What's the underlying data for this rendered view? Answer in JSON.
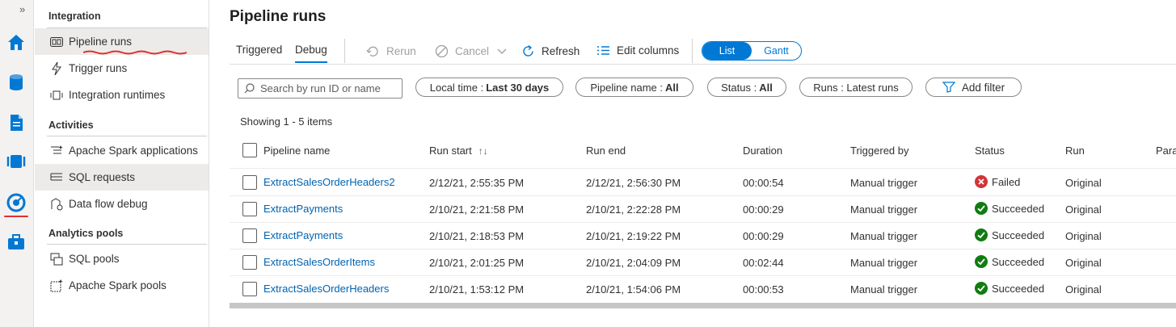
{
  "rail": {
    "expand_glyph": "»",
    "icons": [
      "home-icon",
      "data-icon",
      "develop-icon",
      "integrate-icon",
      "monitor-icon",
      "manage-icon"
    ]
  },
  "nav": {
    "sections": [
      {
        "title": "Integration",
        "items": [
          {
            "label": "Pipeline runs",
            "icon": "pipeline-runs-icon"
          },
          {
            "label": "Trigger runs",
            "icon": "trigger-runs-icon"
          },
          {
            "label": "Integration runtimes",
            "icon": "integration-runtimes-icon"
          }
        ]
      },
      {
        "title": "Activities",
        "items": [
          {
            "label": "Apache Spark applications",
            "icon": "spark-applications-icon"
          },
          {
            "label": "SQL requests",
            "icon": "sql-requests-icon"
          },
          {
            "label": "Data flow debug",
            "icon": "data-flow-debug-icon"
          }
        ]
      },
      {
        "title": "Analytics pools",
        "items": [
          {
            "label": "SQL pools",
            "icon": "sql-pools-icon"
          },
          {
            "label": "Apache Spark pools",
            "icon": "spark-pools-icon"
          }
        ]
      }
    ]
  },
  "main": {
    "title": "Pipeline runs",
    "tabs": [
      "Triggered",
      "Debug"
    ],
    "toolbar": {
      "rerun": "Rerun",
      "cancel": "Cancel",
      "refresh": "Refresh",
      "edit_columns": "Edit columns"
    },
    "view_toggle": [
      "List",
      "Gantt"
    ],
    "search_placeholder": "Search by run ID or name",
    "filters": {
      "time_label": "Local time :",
      "time_value": "Last 30 days",
      "pipeline_label": "Pipeline name :",
      "pipeline_value": "All",
      "status_label": "Status :",
      "status_value": "All",
      "runs_label": "Runs : Latest runs",
      "add_filter": "Add filter"
    },
    "showing": "Showing 1 - 5 items",
    "columns": [
      "Pipeline name",
      "Run start",
      "Run end",
      "Duration",
      "Triggered by",
      "Status",
      "Run",
      "Para"
    ],
    "sort_glyph": "↑↓",
    "rows": [
      {
        "name": "ExtractSalesOrderHeaders2",
        "start": "2/12/21, 2:55:35 PM",
        "end": "2/12/21, 2:56:30 PM",
        "duration": "00:00:54",
        "trigger": "Manual trigger",
        "status": "Failed",
        "run": "Original"
      },
      {
        "name": "ExtractPayments",
        "start": "2/10/21, 2:21:58 PM",
        "end": "2/10/21, 2:22:28 PM",
        "duration": "00:00:29",
        "trigger": "Manual trigger",
        "status": "Succeeded",
        "run": "Original"
      },
      {
        "name": "ExtractPayments",
        "start": "2/10/21, 2:18:53 PM",
        "end": "2/10/21, 2:19:22 PM",
        "duration": "00:00:29",
        "trigger": "Manual trigger",
        "status": "Succeeded",
        "run": "Original"
      },
      {
        "name": "ExtractSalesOrderItems",
        "start": "2/10/21, 2:01:25 PM",
        "end": "2/10/21, 2:04:09 PM",
        "duration": "00:02:44",
        "trigger": "Manual trigger",
        "status": "Succeeded",
        "run": "Original"
      },
      {
        "name": "ExtractSalesOrderHeaders",
        "start": "2/10/21, 1:53:12 PM",
        "end": "2/10/21, 1:54:06 PM",
        "duration": "00:00:53",
        "trigger": "Manual trigger",
        "status": "Succeeded",
        "run": "Original"
      }
    ]
  },
  "colors": {
    "accent": "#0078d4",
    "failed": "#d13438",
    "succeeded": "#107c10",
    "annotation": "#e03030"
  }
}
